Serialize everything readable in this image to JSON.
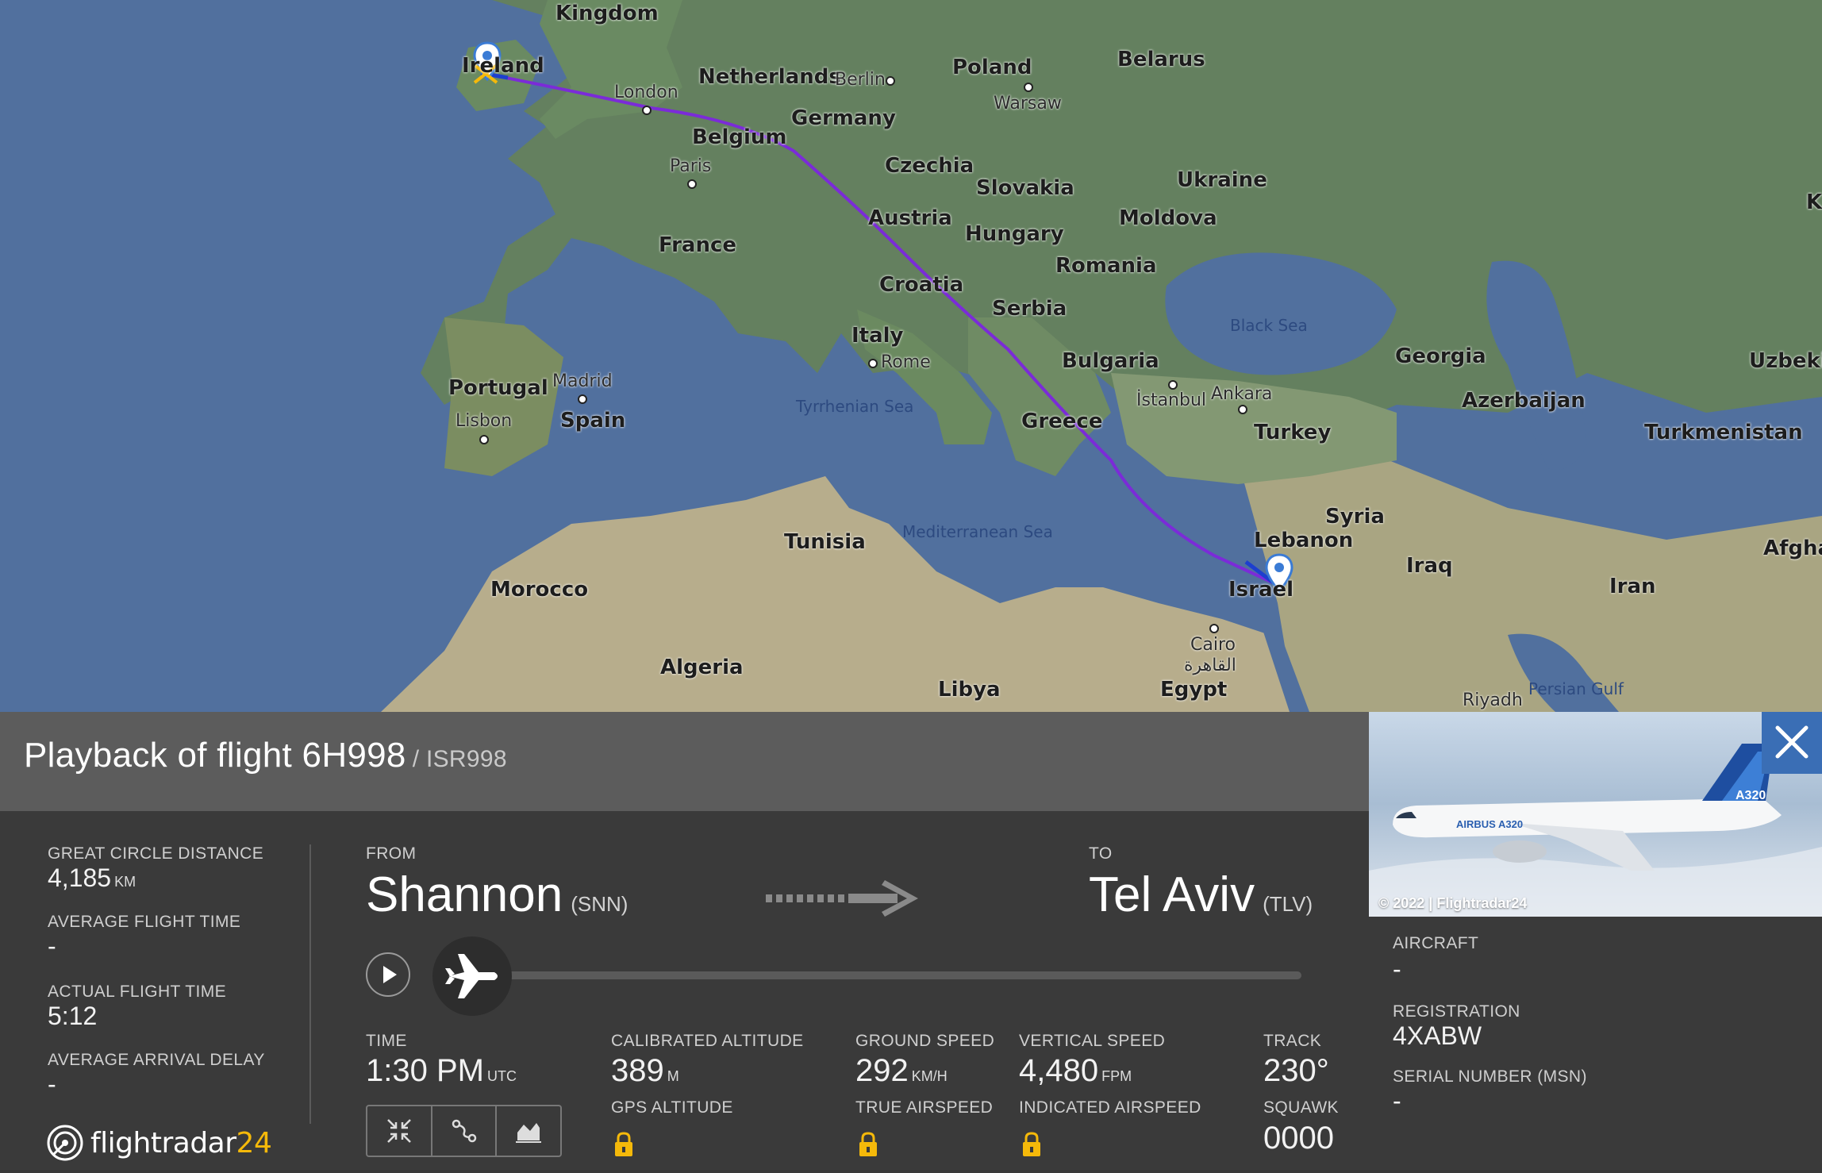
{
  "map": {
    "countries": [
      "Kingdom",
      "Ireland",
      "Netherlands",
      "Germany",
      "Belgium",
      "Poland",
      "Belarus",
      "Czechia",
      "Slovakia",
      "Ukraine",
      "France",
      "Austria",
      "Hungary",
      "Moldova",
      "Romania",
      "Croatia",
      "Serbia",
      "Italy",
      "Bulgaria",
      "Portugal",
      "Spain",
      "Greece",
      "Turkey",
      "Georgia",
      "Azerbaijan",
      "Uzbekis",
      "Turkmenistan",
      "Syria",
      "Lebanon",
      "Israel",
      "Iraq",
      "Iran",
      "Afgha",
      "Tunisia",
      "Morocco",
      "Algeria",
      "Libya",
      "Egypt",
      "K"
    ],
    "cities": [
      "London",
      "Berlin",
      "Warsaw",
      "Paris",
      "Rome",
      "Madrid",
      "Lisbon",
      "İstanbul",
      "Ankara",
      "Cairo",
      "القاهرة",
      "Riyadh"
    ],
    "seas": [
      "Black Sea",
      "Tyrrhenian Sea",
      "Mediterranean Sea",
      "Persian Gulf"
    ],
    "route_color": "#7b2bd8"
  },
  "header": {
    "title": "Playback of flight 6H998",
    "callsign": "/ ISR998"
  },
  "stats": {
    "distance_label": "GREAT CIRCLE DISTANCE",
    "distance_value": "4,185",
    "distance_unit": "KM",
    "avg_time_label": "AVERAGE FLIGHT TIME",
    "avg_time_value": "-",
    "actual_time_label": "ACTUAL FLIGHT TIME",
    "actual_time_value": "5:12",
    "avg_delay_label": "AVERAGE ARRIVAL DELAY",
    "avg_delay_value": "-"
  },
  "route": {
    "from_label": "FROM",
    "from_city": "Shannon",
    "from_code": "(SNN)",
    "to_label": "TO",
    "to_city": "Tel Aviv",
    "to_code": "(TLV)"
  },
  "playback": {
    "progress": 0
  },
  "telemetry": {
    "time_label": "TIME",
    "time_value": "1:30 PM",
    "time_unit": "UTC",
    "cal_alt_label": "CALIBRATED ALTITUDE",
    "cal_alt_value": "389",
    "cal_alt_unit": "M",
    "gps_alt_label": "GPS ALTITUDE",
    "ground_speed_label": "GROUND SPEED",
    "ground_speed_value": "292",
    "ground_speed_unit": "KM/H",
    "true_airspeed_label": "TRUE AIRSPEED",
    "vertical_speed_label": "VERTICAL SPEED",
    "vertical_speed_value": "4,480",
    "vertical_speed_unit": "FPM",
    "indicated_airspeed_label": "INDICATED AIRSPEED",
    "track_label": "TRACK",
    "track_value": "230°",
    "squawk_label": "SQUAWK",
    "squawk_value": "0000"
  },
  "aircraft": {
    "photo_copyright": "© 2022 | Flightradar24",
    "livery_text": "AIRBUS A320",
    "tail_text": "A320",
    "aircraft_label": "AIRCRAFT",
    "aircraft_value": "-",
    "registration_label": "REGISTRATION",
    "registration_value": "4XABW",
    "serial_label": "SERIAL NUMBER (MSN)",
    "serial_value": "-"
  },
  "brand": {
    "name": "flightradar",
    "number": "24"
  }
}
